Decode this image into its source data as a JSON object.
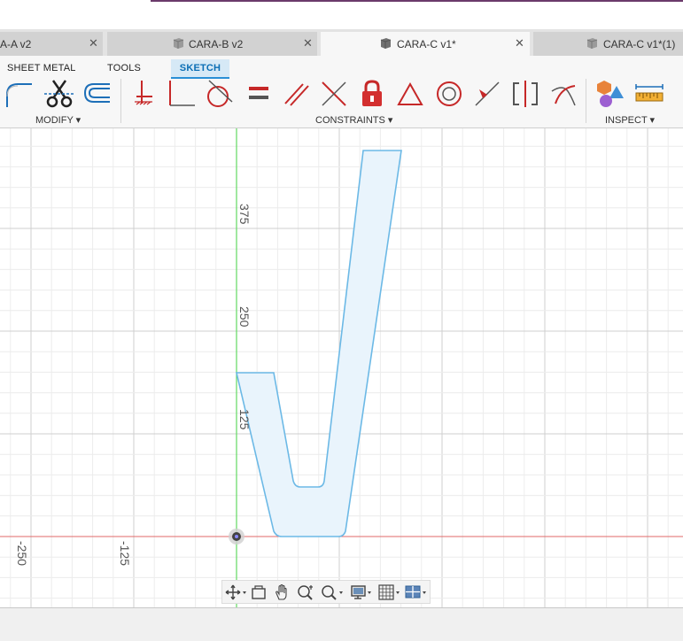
{
  "document_tabs": [
    {
      "label": "A-A v2",
      "active": false
    },
    {
      "label": "CARA-B v2",
      "active": false
    },
    {
      "label": "CARA-C v1*",
      "active": true
    },
    {
      "label": "CARA-C v1*(1)",
      "active": false
    }
  ],
  "close_glyph": "✕",
  "ribbon": {
    "tabs": [
      "SHEET METAL",
      "TOOLS",
      "SKETCH"
    ],
    "active_tab": "SKETCH",
    "groups": {
      "modify": "MODIFY ▾",
      "constraints": "CONSTRAINTS ▾",
      "inspect": "INSPECT ▾"
    }
  },
  "canvas": {
    "axis_labels": {
      "y": [
        "375",
        "250",
        "125"
      ],
      "x": [
        "-250",
        "-125"
      ]
    },
    "colors": {
      "profile_stroke": "#6cb9e6",
      "profile_fill": "#e9f4fc",
      "y_axis": "#62d962",
      "x_axis": "#e06a6a",
      "grid": "#e6e6e6"
    }
  },
  "nav_toolbar": {
    "icons": [
      "orbit-icon",
      "look-at-icon",
      "pan-icon",
      "zoom-icon",
      "fit-icon",
      "display-settings-icon",
      "grid-settings-icon",
      "viewports-icon"
    ]
  }
}
